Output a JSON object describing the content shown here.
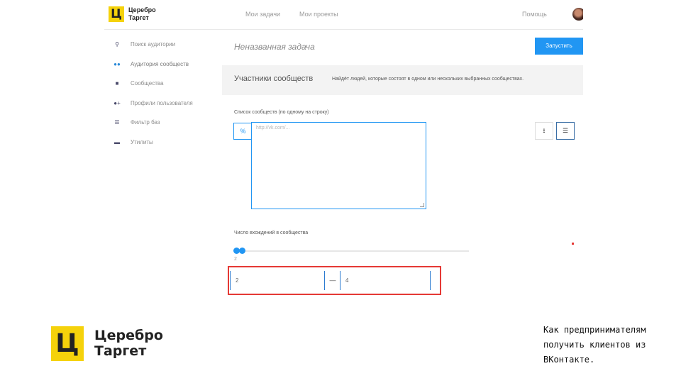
{
  "app": {
    "logo_glyph": "Ц",
    "logo_line1": "Церебро",
    "logo_line2": "Таргет"
  },
  "topnav": {
    "links": [
      "Мои задачи",
      "Мои проекты",
      "Помощь"
    ]
  },
  "sidebar": {
    "items": [
      {
        "label": "Поиск аудитории",
        "icon": "search-icon"
      },
      {
        "label": "Аудитория сообществ",
        "icon": "users-icon",
        "active": true
      },
      {
        "label": "Сообщества",
        "icon": "chat-icon"
      },
      {
        "label": "Профили пользователя",
        "icon": "user-plus-icon"
      },
      {
        "label": "Фильтр баз",
        "icon": "database-icon"
      },
      {
        "label": "Утилиты",
        "icon": "minus-icon"
      }
    ]
  },
  "task": {
    "title": "Неназванная задача",
    "run_button": "Запустить"
  },
  "section": {
    "title": "Участники сообществ",
    "description": "Найдёт людей, которые состоят в одном или нескольких выбранных сообществах."
  },
  "form": {
    "communities_label": "Список сообществ (по одному на строку)",
    "communities_placeholder": "http://vk.com/...",
    "link_addon": "%",
    "upload_icon": "download-icon",
    "list_icon": "list-icon",
    "count_label": "Число вхождений в сообщества",
    "slider_min_label": "2 ",
    "slider_from": 2,
    "slider_to": 4,
    "range_from": "2",
    "range_dash": "—",
    "range_to": "4"
  },
  "brand": {
    "glyph": "Ц",
    "line1": "Церебро",
    "line2": "Таргет"
  },
  "caption": {
    "line1": "Как предпринимателям",
    "line2": "получить клиентов из",
    "line3": "ВКонтакте."
  },
  "colors": {
    "accent": "#2196f3",
    "brand_yellow": "#f5d20b",
    "highlight_red": "#e53935"
  }
}
